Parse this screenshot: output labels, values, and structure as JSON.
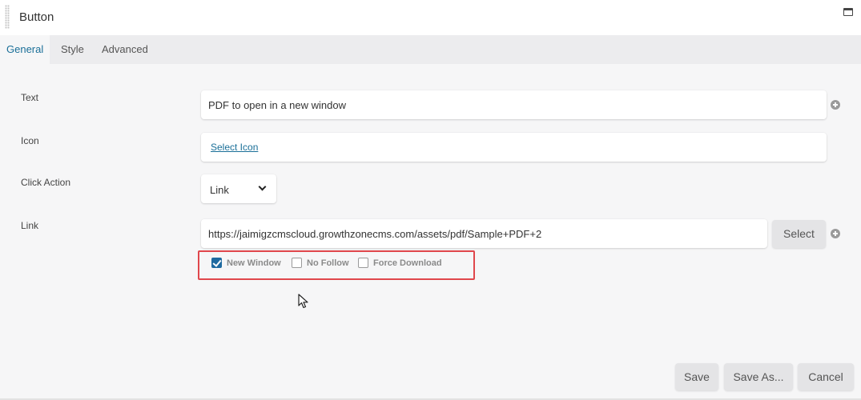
{
  "window": {
    "title": "Button"
  },
  "tabs": [
    {
      "label": "General",
      "active": true
    },
    {
      "label": "Style",
      "active": false
    },
    {
      "label": "Advanced",
      "active": false
    }
  ],
  "form": {
    "text": {
      "label": "Text",
      "value": "PDF to open in a new window"
    },
    "icon": {
      "label": "Icon",
      "link": "Select Icon"
    },
    "click_action": {
      "label": "Click Action",
      "value": "Link"
    },
    "link": {
      "label": "Link",
      "value": "https://jaimigzcmscloud.growthzonecms.com/assets/pdf/Sample+PDF+2",
      "select_label": "Select",
      "options": [
        {
          "label": "New Window",
          "checked": true
        },
        {
          "label": "No Follow",
          "checked": false
        },
        {
          "label": "Force Download",
          "checked": false
        }
      ]
    }
  },
  "footer": {
    "save": "Save",
    "save_as": "Save As...",
    "cancel": "Cancel"
  },
  "colors": {
    "accent": "#1a6f98",
    "highlight": "#e0474c",
    "checkbox": "#1f6aa0"
  }
}
